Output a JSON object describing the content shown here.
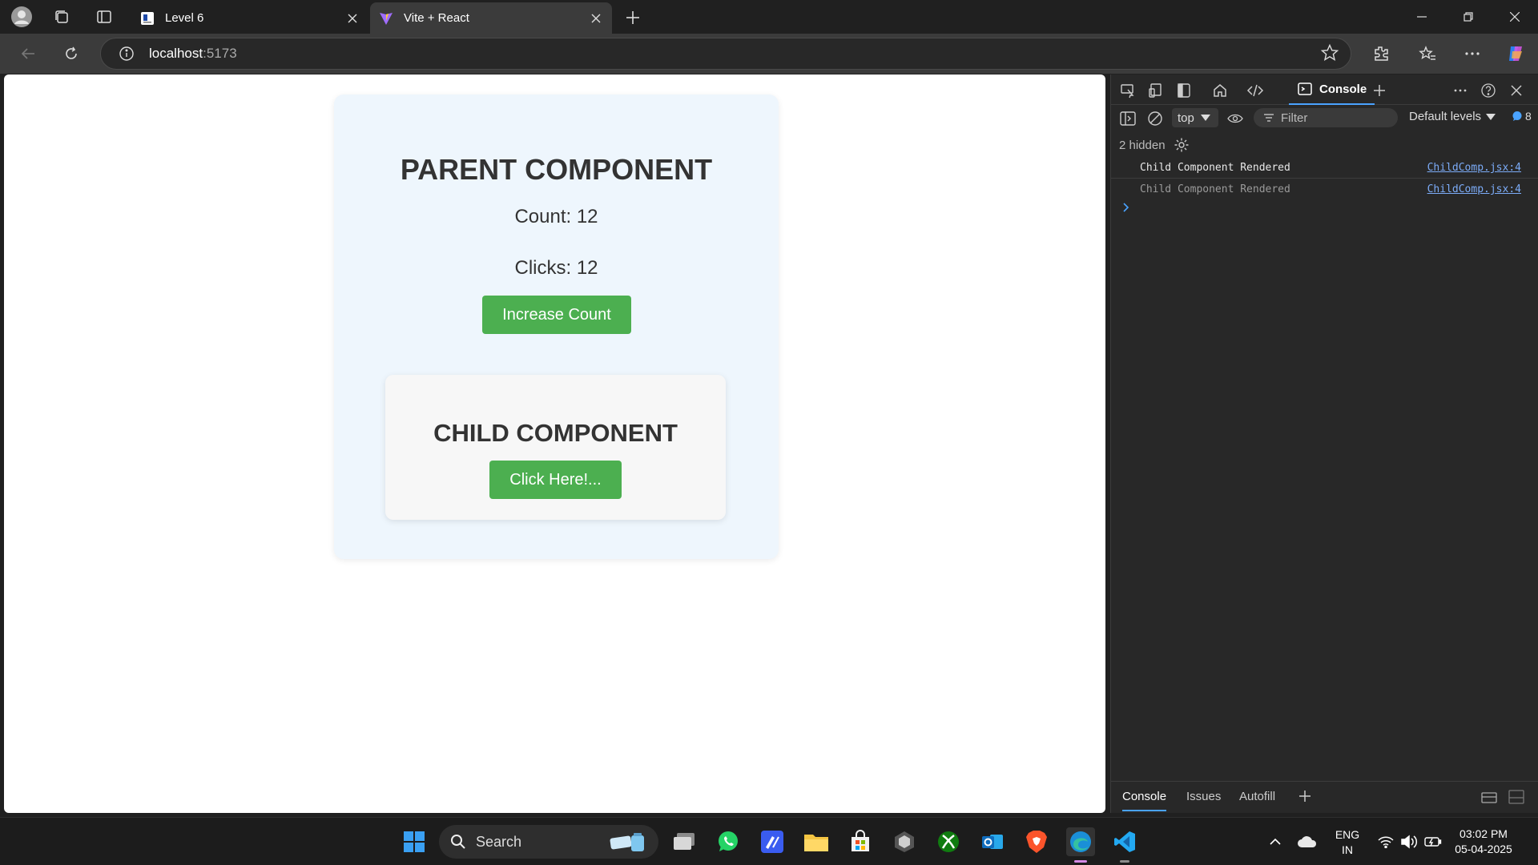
{
  "browser": {
    "tabs": [
      {
        "title": "Level 6",
        "active": false
      },
      {
        "title": "Vite + React",
        "active": true
      }
    ],
    "url_host": "localhost",
    "url_port": ":5173"
  },
  "page": {
    "parent_title": "PARENT COMPONENT",
    "count_text": "Count: 12",
    "clicks_text": "Clicks: 12",
    "increase_button": "Increase Count",
    "child_title": "CHILD COMPONENT",
    "child_button": "Click Here!..."
  },
  "devtools": {
    "active_tab": "Console",
    "context": "top",
    "filter_placeholder": "Filter",
    "levels": "Default levels",
    "message_count": "8",
    "hidden": "2 hidden",
    "logs": [
      {
        "message": "Child Component Rendered",
        "source": "ChildComp.jsx:4"
      },
      {
        "message": "Child Component Rendered",
        "source": "ChildComp.jsx:4"
      }
    ],
    "drawer_tabs": [
      "Console",
      "Issues",
      "Autofill"
    ]
  },
  "taskbar": {
    "search_label": "Search",
    "lang_top": "ENG",
    "lang_bottom": "IN",
    "time": "03:02 PM",
    "date": "05-04-2025"
  },
  "colors": {
    "accent_green": "#4caf50",
    "parent_bg": "#eef6fd",
    "child_bg": "#f7f7f7",
    "link_blue": "#7cacf8"
  }
}
